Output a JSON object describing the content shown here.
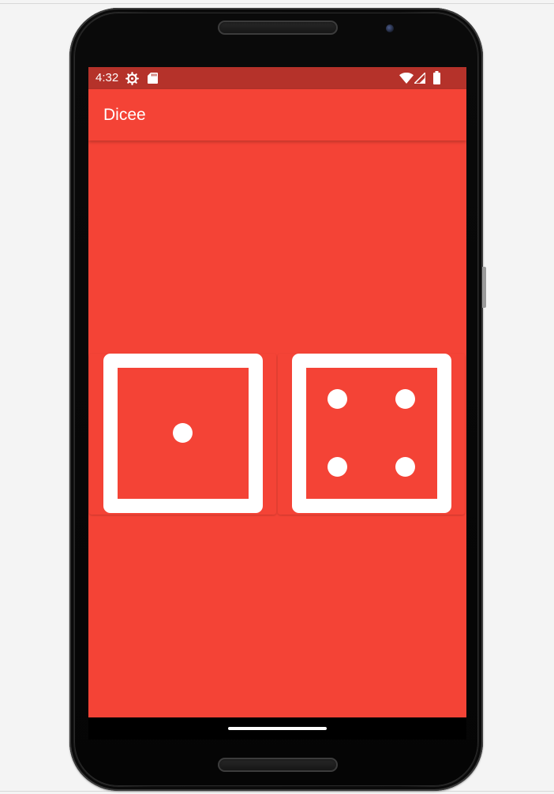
{
  "status_bar": {
    "time": "4:32",
    "icons": [
      "gear-icon",
      "sd-card-icon",
      "wifi-icon",
      "cell-signal-icon",
      "battery-icon"
    ]
  },
  "app_bar": {
    "title": "Dicee"
  },
  "dice": {
    "left": {
      "face": 1
    },
    "right": {
      "face": 4
    }
  },
  "colors": {
    "primary": "#f44336",
    "status_bar": "#b5322a",
    "pip": "#ffffff"
  }
}
